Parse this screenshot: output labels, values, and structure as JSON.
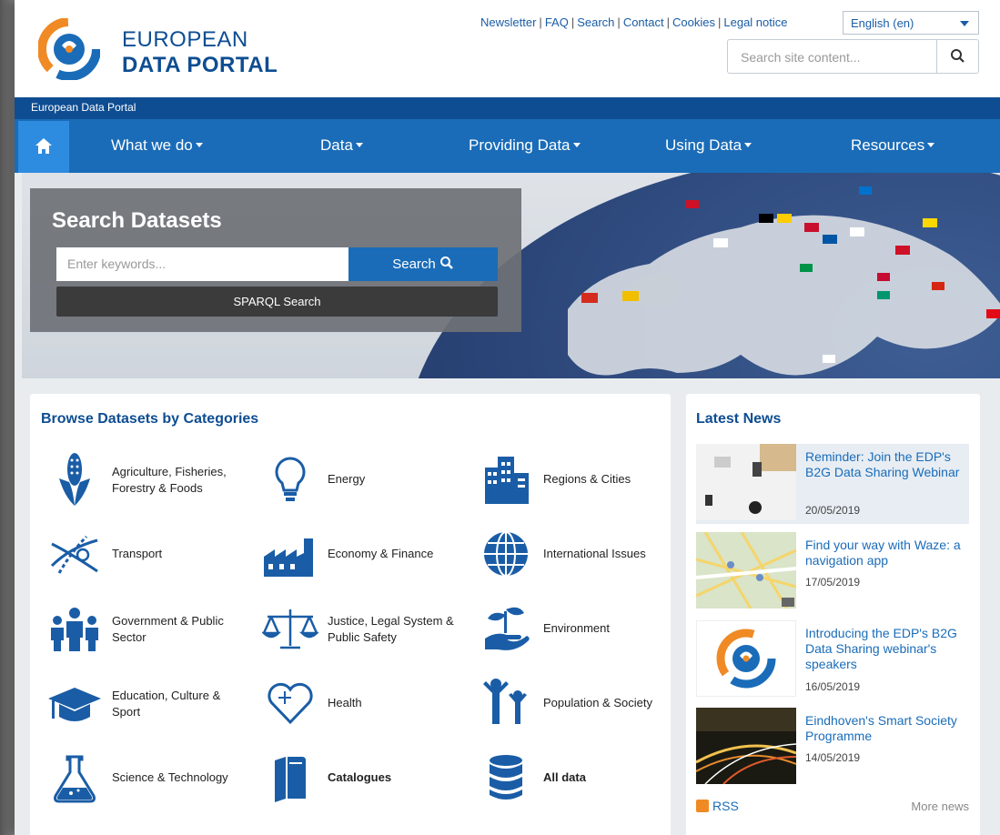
{
  "logo": {
    "line1": "EUROPEAN",
    "line2": "DATA PORTAL"
  },
  "toplinks": [
    "Newsletter",
    "FAQ",
    "Search",
    "Contact",
    "Cookies",
    "Legal notice"
  ],
  "language": {
    "selected": "English (en)"
  },
  "site_search": {
    "placeholder": "Search site content..."
  },
  "breadcrumb": "European Data Portal",
  "nav": {
    "items": [
      "What we do",
      "Data",
      "Providing Data",
      "Using Data",
      "Resources"
    ]
  },
  "hero": {
    "title": "Search Datasets",
    "keyword_placeholder": "Enter keywords...",
    "search_label": "Search",
    "sparql_label": "SPARQL Search"
  },
  "categories": {
    "title": "Browse Datasets by Categories",
    "items": [
      {
        "label": "Agriculture, Fisheries, Forestry & Foods",
        "icon": "corn-icon"
      },
      {
        "label": "Energy",
        "icon": "lightbulb-icon"
      },
      {
        "label": "Regions & Cities",
        "icon": "buildings-icon"
      },
      {
        "label": "Transport",
        "icon": "roads-icon"
      },
      {
        "label": "Economy & Finance",
        "icon": "factory-icon"
      },
      {
        "label": "International Issues",
        "icon": "globe-icon"
      },
      {
        "label": "Government & Public Sector",
        "icon": "people-icon"
      },
      {
        "label": "Justice, Legal System & Public Safety",
        "icon": "scales-icon"
      },
      {
        "label": "Environment",
        "icon": "plant-hand-icon"
      },
      {
        "label": "Education, Culture & Sport",
        "icon": "graduation-cap-icon"
      },
      {
        "label": "Health",
        "icon": "heart-icon"
      },
      {
        "label": "Population & Society",
        "icon": "family-icon"
      },
      {
        "label": "Science & Technology",
        "icon": "flask-icon"
      },
      {
        "label": "Catalogues",
        "icon": "books-icon"
      },
      {
        "label": "All data",
        "icon": "database-icon"
      }
    ]
  },
  "news": {
    "title": "Latest News",
    "items": [
      {
        "title": "Reminder: Join the EDP's B2G Data Sharing Webinar",
        "date": "20/05/2019"
      },
      {
        "title": "Find your way with Waze: a navigation app",
        "date": "17/05/2019"
      },
      {
        "title": "Introducing the EDP's B2G Data Sharing webinar's speakers",
        "date": "16/05/2019"
      },
      {
        "title": "Eindhoven's Smart Society Programme",
        "date": "14/05/2019"
      }
    ],
    "rss_label": "RSS",
    "more_label": "More news"
  },
  "colors": {
    "brand_dark": "#0e4d92",
    "brand": "#1a6cb8",
    "accent_orange": "#f08a24"
  }
}
